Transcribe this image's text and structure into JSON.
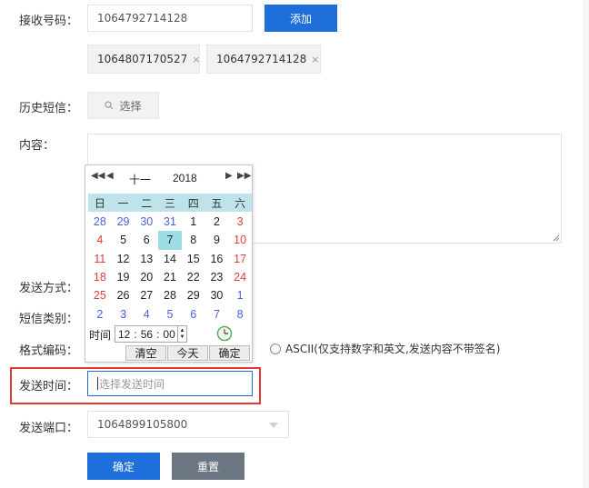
{
  "form": {
    "receiver_label": "接收号码：",
    "receiver_value": "1064792714128",
    "add_button": "添加",
    "tags": [
      {
        "text": "1064807170527",
        "remove": "×"
      },
      {
        "text": "1064792714128",
        "remove": "×"
      }
    ],
    "history_label": "历史短信：",
    "history_button": "选择",
    "content_label": "内容：",
    "send_mode_label": "发送方式：",
    "sms_type_label": "短信类别：",
    "encoding_label": "格式编码：",
    "ascii_option": "ASCII(仅支持数字和英文,发送内容不带签名)",
    "send_time_label": "发送时间：",
    "send_time_placeholder": "选择发送时间",
    "port_label": "发送端口：",
    "port_value": "1064899105800",
    "confirm_button": "确定",
    "reset_button": "重置"
  },
  "calendar": {
    "month": "十一",
    "year": "2018",
    "weekdays": [
      "日",
      "一",
      "二",
      "三",
      "四",
      "五",
      "六"
    ],
    "weeks": [
      [
        "28",
        "29",
        "30",
        "31",
        "1",
        "2",
        "3"
      ],
      [
        "4",
        "5",
        "6",
        "7",
        "8",
        "9",
        "10"
      ],
      [
        "11",
        "12",
        "13",
        "14",
        "15",
        "16",
        "17"
      ],
      [
        "18",
        "19",
        "20",
        "21",
        "22",
        "23",
        "24"
      ],
      [
        "25",
        "26",
        "27",
        "28",
        "29",
        "30",
        "1"
      ],
      [
        "2",
        "3",
        "4",
        "5",
        "6",
        "7",
        "8"
      ]
    ],
    "selected_day": "7",
    "time_label": "时间",
    "hour": "12",
    "minute": "56",
    "second": "00",
    "clear_button": "清空",
    "today_button": "今天",
    "ok_button": "确定"
  },
  "colors": {
    "primary": "#1e6fd9",
    "gray_button": "#6b7682",
    "highlight_border": "#e53935",
    "calendar_header": "#bfe3eb",
    "selected_day": "#9fdde4"
  }
}
